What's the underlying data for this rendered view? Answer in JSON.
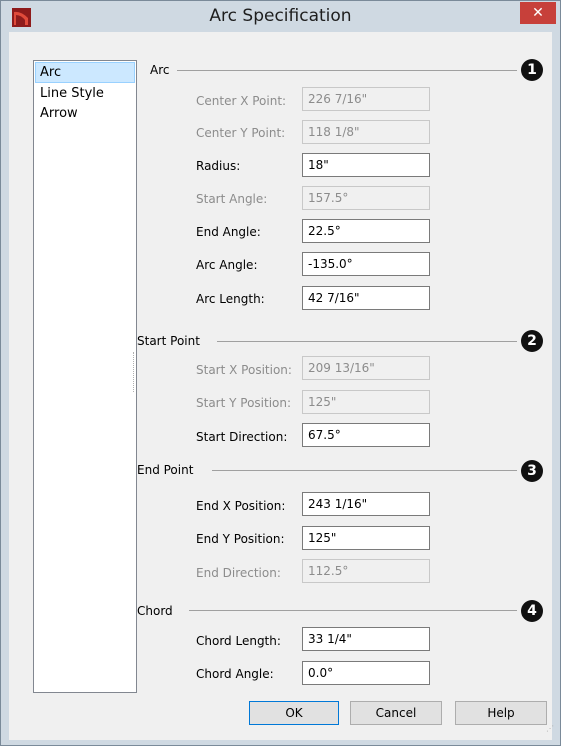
{
  "window": {
    "title": "Arc Specification",
    "close_symbol": "✕"
  },
  "nav": {
    "items": [
      "Arc",
      "Line Style",
      "Arrow"
    ],
    "selected": "Arc"
  },
  "sections": {
    "arc": {
      "title": "Arc",
      "badge": "1",
      "rows": [
        {
          "label": "Center X Point:",
          "value": "226 7/16\"",
          "enabled": false
        },
        {
          "label": "Center Y Point:",
          "value": "118 1/8\"",
          "enabled": false
        },
        {
          "label": "Radius:",
          "value": "18\"",
          "enabled": true
        },
        {
          "label": "Start Angle:",
          "value": "157.5°",
          "enabled": false
        },
        {
          "label": "End Angle:",
          "value": "22.5°",
          "enabled": true
        },
        {
          "label": "Arc Angle:",
          "value": "-135.0°",
          "enabled": true
        },
        {
          "label": "Arc Length:",
          "value": "42 7/16\"",
          "enabled": true
        }
      ]
    },
    "start": {
      "title": "Start Point",
      "badge": "2",
      "rows": [
        {
          "label": "Start X Position:",
          "value": "209 13/16\"",
          "enabled": false
        },
        {
          "label": "Start Y Position:",
          "value": "125\"",
          "enabled": false
        },
        {
          "label": "Start Direction:",
          "value": "67.5°",
          "enabled": true
        }
      ]
    },
    "end": {
      "title": "End Point",
      "badge": "3",
      "rows": [
        {
          "label": "End X Position:",
          "value": "243 1/16\"",
          "enabled": true
        },
        {
          "label": "End Y Position:",
          "value": "125\"",
          "enabled": true
        },
        {
          "label": "End Direction:",
          "value": "112.5°",
          "enabled": false
        }
      ]
    },
    "chord": {
      "title": "Chord",
      "badge": "4",
      "rows": [
        {
          "label": "Chord Length:",
          "value": "33 1/4\"",
          "enabled": true
        },
        {
          "label": "Chord Angle:",
          "value": "0.0°",
          "enabled": true
        }
      ]
    }
  },
  "buttons": {
    "ok": "OK",
    "cancel": "Cancel",
    "help": "Help"
  },
  "colors": {
    "badge": "#111111",
    "close": "#c7403a",
    "app_icon": "#c0392b"
  }
}
